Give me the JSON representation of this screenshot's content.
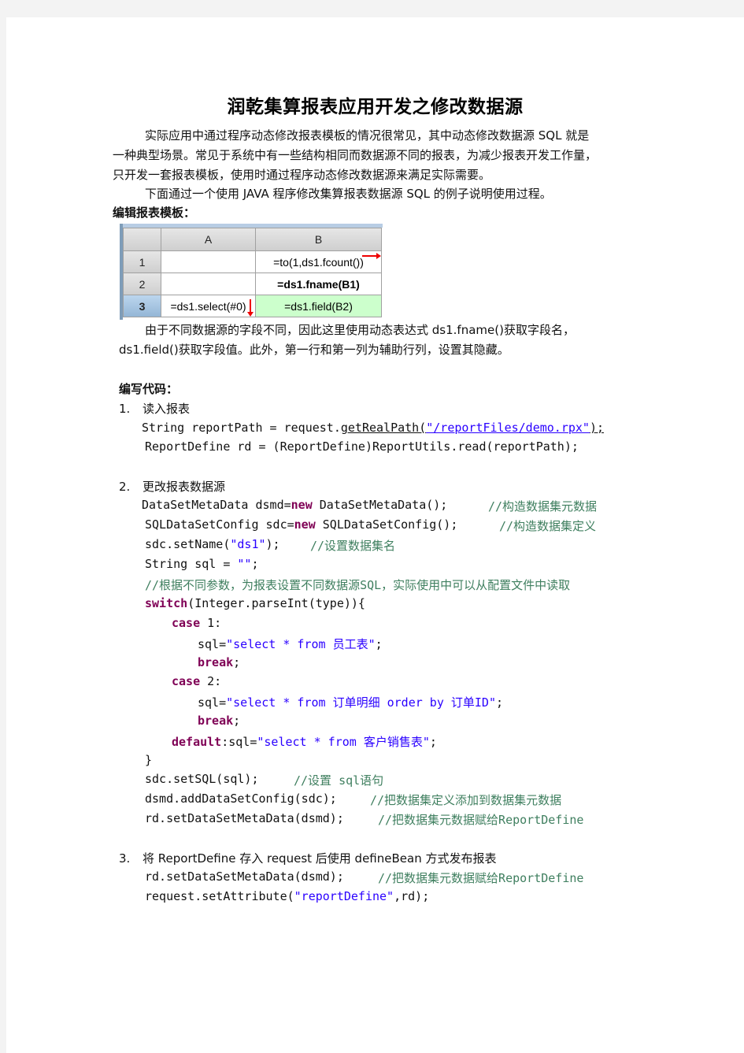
{
  "title": "润乾集算报表应用开发之修改数据源",
  "intro": {
    "p1_line1": "实际应用中通过程序动态修改报表模板的情况很常见，其中动态修改数据源  SQL 就是",
    "p1_line2": "一种典型场景。常见于系统中有一些结构相同而数据源不同的报表，为减少报表开发工作量，",
    "p1_line3": "只开发一套报表模板，使用时通过程序动态修改数据源来满足实际需要。",
    "p2": "下面通过一个使用 JAVA 程序修改集算报表数据源 SQL 的例子说明使用过程。"
  },
  "edit_template_heading": "编辑报表模板：",
  "sheet": {
    "columns": [
      "A",
      "B"
    ],
    "rows": [
      {
        "label": "1",
        "a": "",
        "b": "=to(1,ds1.fcount())"
      },
      {
        "label": "2",
        "a": "",
        "b": "=ds1.fname(B1)"
      },
      {
        "label": "3",
        "a": "=ds1.select(#0)",
        "b": "=ds1.field(B2)"
      }
    ],
    "selected_row": "3",
    "colors": {
      "header_bg": "#d8d8d8",
      "selected_row_bg": "#a8c4e0",
      "highlight_cell_bg": "#ccffcc",
      "arrow": "#e00000"
    }
  },
  "explain": {
    "line1": "由于不同数据源的字段不同，因此这里使用动态表达式  ds1.fname()获取字段名，",
    "line2": "ds1.field()获取字段值。此外，第一行和第一列为辅助行列，设置其隐藏。"
  },
  "write_code_heading": "编写代码：",
  "steps": [
    {
      "num": "1.",
      "label": "读入报表"
    },
    {
      "num": "2.",
      "label": "更改报表数据源"
    },
    {
      "num": "3.",
      "label": "将 ReportDefine 存入 request 后使用 defineBean 方式发布报表"
    }
  ],
  "code1": {
    "l1_a": "String reportPath = request.",
    "l1_b": "getRealPath(",
    "l1_c": "\"/reportFiles/demo.rpx\"",
    "l1_d": ");",
    "l2": "ReportDefine rd = (ReportDefine)ReportUtils.read(reportPath);"
  },
  "code2": {
    "l1_a": "DataSetMetaData dsmd=",
    "l1_kw": "new",
    "l1_b": " DataSetMetaData();",
    "l1_c": "//构造数据集元数据",
    "l2_a": "SQLDataSetConfig sdc=",
    "l2_kw": "new",
    "l2_b": " SQLDataSetConfig();",
    "l2_c": "//构造数据集定义",
    "l3_a": "sdc.setName(",
    "l3_s": "\"ds1\"",
    "l3_b": ");",
    "l3_c": "//设置数据集名",
    "l4_a": "String sql = ",
    "l4_s": "\"\"",
    "l4_b": ";",
    "l5_c": "//根据不同参数，为报表设置不同数据源SQL，实际使用中可以从配置文件中读取",
    "l6_kw": "switch",
    "l6_b": "(Integer.parseInt(type)){",
    "l7_kw": "case",
    "l7_b": " 1:",
    "l8_a": "sql=",
    "l8_s": "\"select * from 员工表\"",
    "l8_b": ";",
    "l9_kw": "break",
    "l9_b": ";",
    "l10_kw": "case",
    "l10_b": " 2:",
    "l11_a": "sql=",
    "l11_s": "\"select * from 订单明细 order by 订单ID\"",
    "l11_b": ";",
    "l12_kw": "break",
    "l12_b": ";",
    "l13_kw": "default",
    "l13_a": ":sql=",
    "l13_s": "\"select * from 客户销售表\"",
    "l13_b": ";",
    "l14": "}",
    "l15_a": "sdc.setSQL(sql);",
    "l15_c": "//设置 sql语句",
    "l16_a": "dsmd.addDataSetConfig(sdc);",
    "l16_c": "//把数据集定义添加到数据集元数据",
    "l17_a": "rd.setDataSetMetaData(dsmd);",
    "l17_c": "//把数据集元数据赋给ReportDefine"
  },
  "code3": {
    "l1_a": "rd.setDataSetMetaData(dsmd);",
    "l1_c": "//把数据集元数据赋给ReportDefine",
    "l2_a": "request.setAttribute(",
    "l2_s": "\"reportDefine\"",
    "l2_b": ",rd);"
  }
}
